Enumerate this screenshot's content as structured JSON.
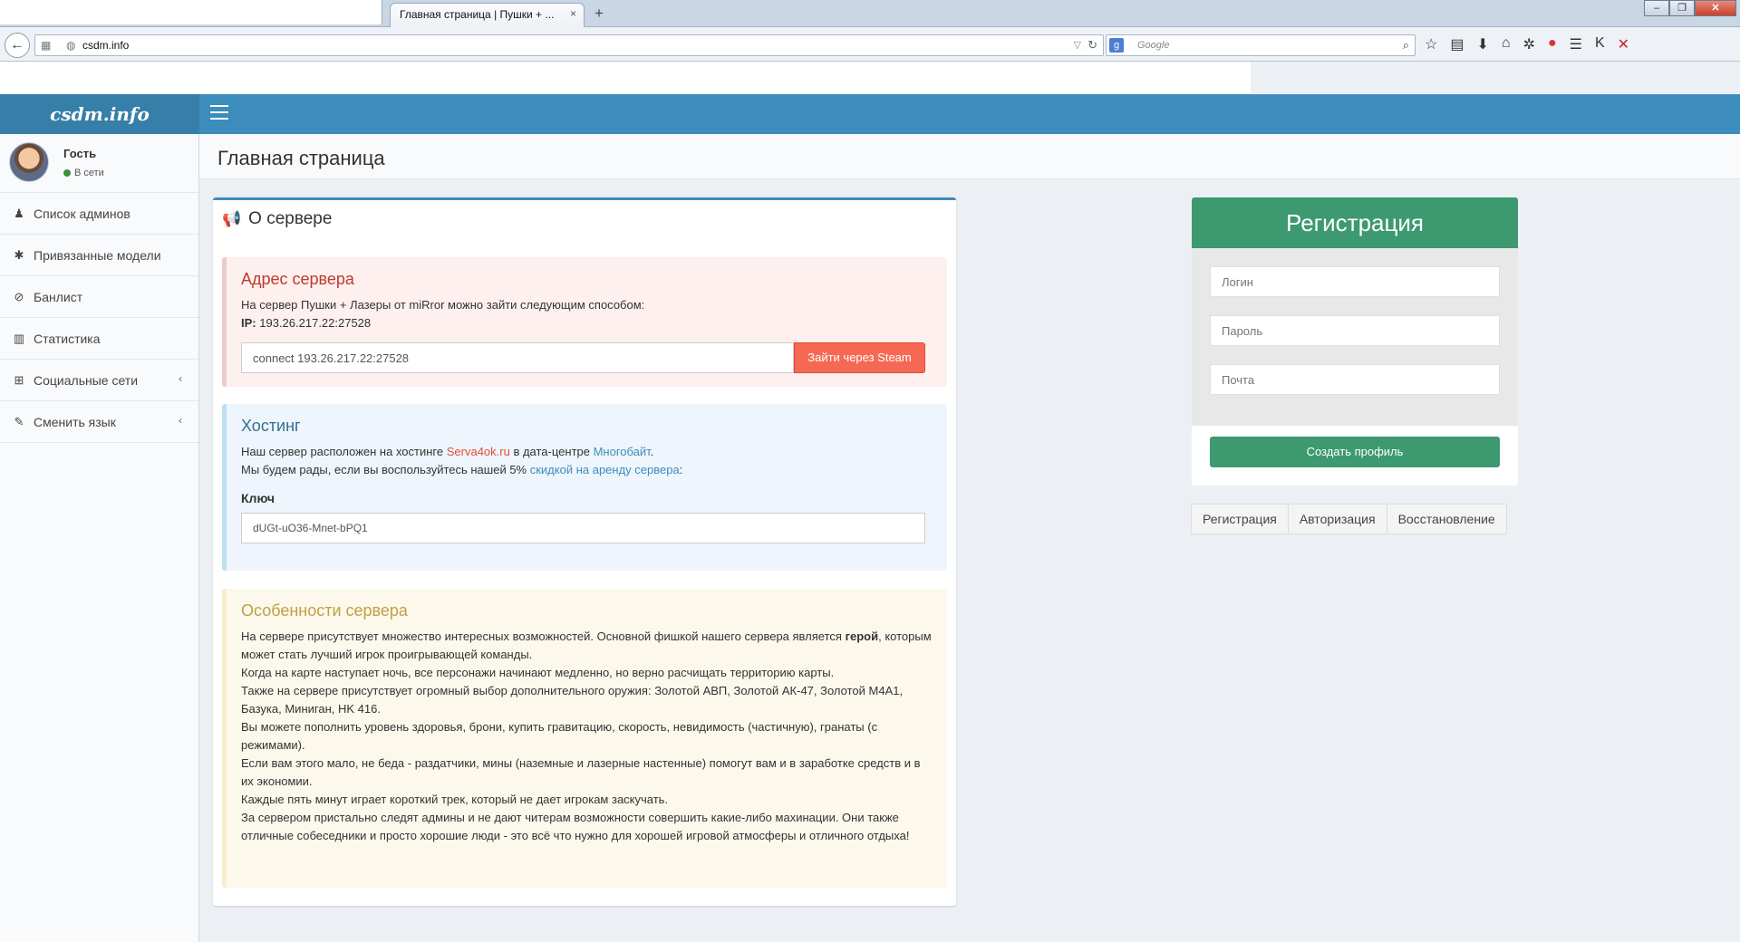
{
  "browser": {
    "tab_title": "Главная страница | Пушки + ...",
    "tab_close": "×",
    "new_tab": "+",
    "url": "csdm.info",
    "search_placeholder": "Google"
  },
  "site": {
    "logo": "csdm.info",
    "page_title": "Главная страница"
  },
  "user": {
    "name": "Гость",
    "status": "В сети"
  },
  "sidebar": {
    "items": [
      {
        "label": "Список админов",
        "icon": "user-icon"
      },
      {
        "label": "Привязанные модели",
        "icon": "bug-icon"
      },
      {
        "label": "Банлист",
        "icon": "ban-icon"
      },
      {
        "label": "Статистика",
        "icon": "bar-chart-icon"
      },
      {
        "label": "Социальные сети",
        "icon": "plus-square-icon",
        "chevron": "‹"
      },
      {
        "label": "Сменить язык",
        "icon": "pencil-icon",
        "chevron": "‹"
      }
    ]
  },
  "server_box": {
    "title": "О сервере",
    "address": {
      "heading": "Адрес сервера",
      "text": "На сервер Пушки + Лазеры от miRror можно зайти следующим способом:",
      "ip_label": "IP:",
      "ip": "193.26.217.22:27528",
      "connect_value": "connect 193.26.217.22:27528",
      "steam_button": "Зайти через Steam"
    },
    "hosting": {
      "heading": "Хостинг",
      "line1_a": "Наш сервер расположен на хостинге ",
      "host_link": "Serva4ok.ru",
      "line1_b": " в дата-центре ",
      "dc_link": "Многобайт",
      "line1_c": ".",
      "line2_a": "Мы будем рады, если вы воспользуйтесь нашей 5% ",
      "discount_link": "скидкой на аренду сервера",
      "line2_b": ":",
      "key_label": "Ключ",
      "key_value": "dUGt-uO36-Mnet-bPQ1"
    },
    "features": {
      "heading": "Особенности сервера",
      "p1_a": "На сервере присутствует множество интересных возможностей. Основной фишкой нашего сервера является ",
      "p1_bold": "герой",
      "p1_b": ", которым может стать лучший игрок проигрывающей команды.",
      "p2": "Когда на карте наступает ночь, все персонажи начинают медленно, но верно расчищать территорию карты.",
      "p3": "Также на сервере присутствует огромный выбор дополнительного оружия: Золотой АВП, Золотой АК-47, Золотой M4A1, Базука, Миниган, HK 416.",
      "p4": "Вы можете пополнить уровень здоровья, брони, купить гравитацию, скорость, невидимость (частичную), гранаты (с режимами).",
      "p5": "Если вам этого мало, не беда - раздатчики, мины (наземные и лазерные настенные) помогут вам и в заработке средств и в их экономии.",
      "p6": "Каждые пять минут играет короткий трек, который не дает игрокам заскучать.",
      "p7": "За сервером пристально следят админы и не дают читерам возможности совершить какие-либо махинации. Они также отличные собеседники и просто хорошие люди - это всё что нужно для хорошей игровой атмосферы и отличного отдыха!"
    }
  },
  "registration": {
    "title": "Регистрация",
    "login_placeholder": "Логин",
    "password_placeholder": "Пароль",
    "email_placeholder": "Почта",
    "submit": "Создать профиль",
    "tabs": [
      "Регистрация",
      "Авторизация",
      "Восстановление"
    ]
  },
  "colors": {
    "topbar": "#3c8dbc",
    "reg_green": "#3d9970",
    "steam_button": "#f56954"
  }
}
